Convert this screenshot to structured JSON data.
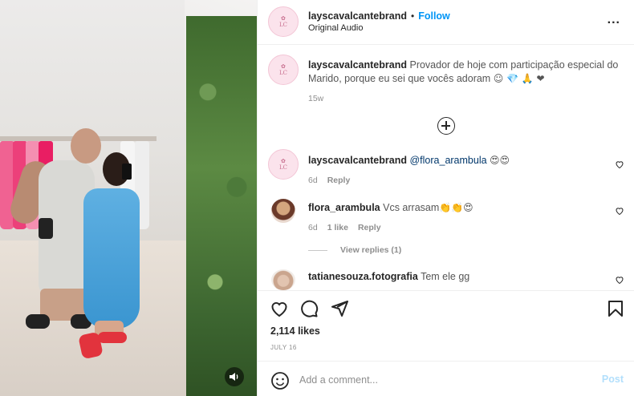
{
  "post": {
    "account": {
      "username": "layscavalcantebrand",
      "bullet": "•",
      "follow_label": "Follow",
      "audio": "Original Audio",
      "more_label": "..."
    },
    "caption": {
      "username": "layscavalcantebrand",
      "text": "Provador de hoje com participação especial do Marido, porque eu sei que vocês adoram",
      "emojis": "☺ 💎 🙏 ❤",
      "age": "15w"
    },
    "comments": [
      {
        "username": "layscavalcantebrand",
        "mention": "@flora_arambula",
        "emojis": "😍😍",
        "age": "6d",
        "likes": "",
        "reply_label": "Reply"
      },
      {
        "username": "flora_arambula",
        "text": "Vcs arrasam",
        "emojis": "👏👏😍",
        "age": "6d",
        "likes": "1 like",
        "reply_label": "Reply",
        "view_replies": "View replies (1)"
      },
      {
        "username": "tatianesouza.fotografia",
        "text": "Tem ele gg"
      }
    ],
    "likes_label": "2,114 likes",
    "date": "JULY 16",
    "comment_box": {
      "placeholder": "Add a comment...",
      "post_label": "Post"
    },
    "icons": {
      "like": "heart-icon",
      "comment": "comment-icon",
      "share": "share-icon",
      "save": "bookmark-icon",
      "emoji": "emoji-icon",
      "more": "more-icon",
      "sound": "speaker-icon",
      "load_more": "plus-circle-icon"
    },
    "colors": {
      "follow_blue": "#0095f6",
      "post_disabled": "#b2dffc",
      "text_primary": "#262626",
      "text_secondary": "#8e8e8e",
      "mention": "#00376b"
    }
  }
}
